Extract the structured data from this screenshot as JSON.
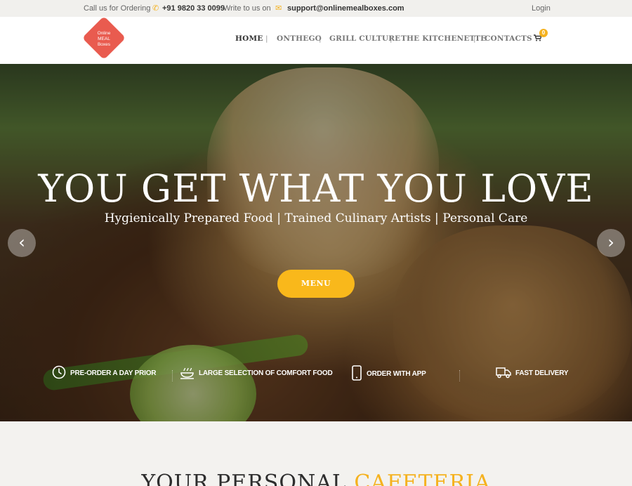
{
  "topbar": {
    "call_label": "Call us for Ordering",
    "phone": "+91 9820 33 0099",
    "write_label": "Write to us on",
    "email": "support@onlinemealboxes.com",
    "login": "Login"
  },
  "logo": {
    "line1": "Online",
    "line2": "MEAL",
    "line3": "Boxes"
  },
  "nav": {
    "items": [
      "HOME",
      "ONTHEGO",
      "GRILL CULTURE",
      "THE KITCHENETTE",
      "CONTACTS"
    ],
    "separator": "|",
    "cart_count": "0"
  },
  "hero": {
    "title": "YOU GET WHAT YOU LOVE",
    "subtitle": "Hygienically Prepared Food | Trained Culinary Artists | Personal Care",
    "button": "MENU",
    "prev_arrow": "‹",
    "next_arrow": "›"
  },
  "features": [
    {
      "label": "PRE-ORDER A DAY PRIOR",
      "icon": "clock-icon"
    },
    {
      "label": "LARGE SELECTION OF COMFORT FOOD",
      "icon": "food-bowl-icon"
    },
    {
      "label": "ORDER WITH APP",
      "icon": "mobile-phone-icon"
    },
    {
      "label": "FAST DELIVERY",
      "icon": "delivery-truck-icon"
    }
  ],
  "section": {
    "title_part1": "YOUR PERSONAL",
    "title_part2": "CAFETERIA"
  },
  "colors": {
    "accent": "#f9b81b",
    "logo": "#e95b4f",
    "topbar_bg": "#f1f0ed"
  }
}
